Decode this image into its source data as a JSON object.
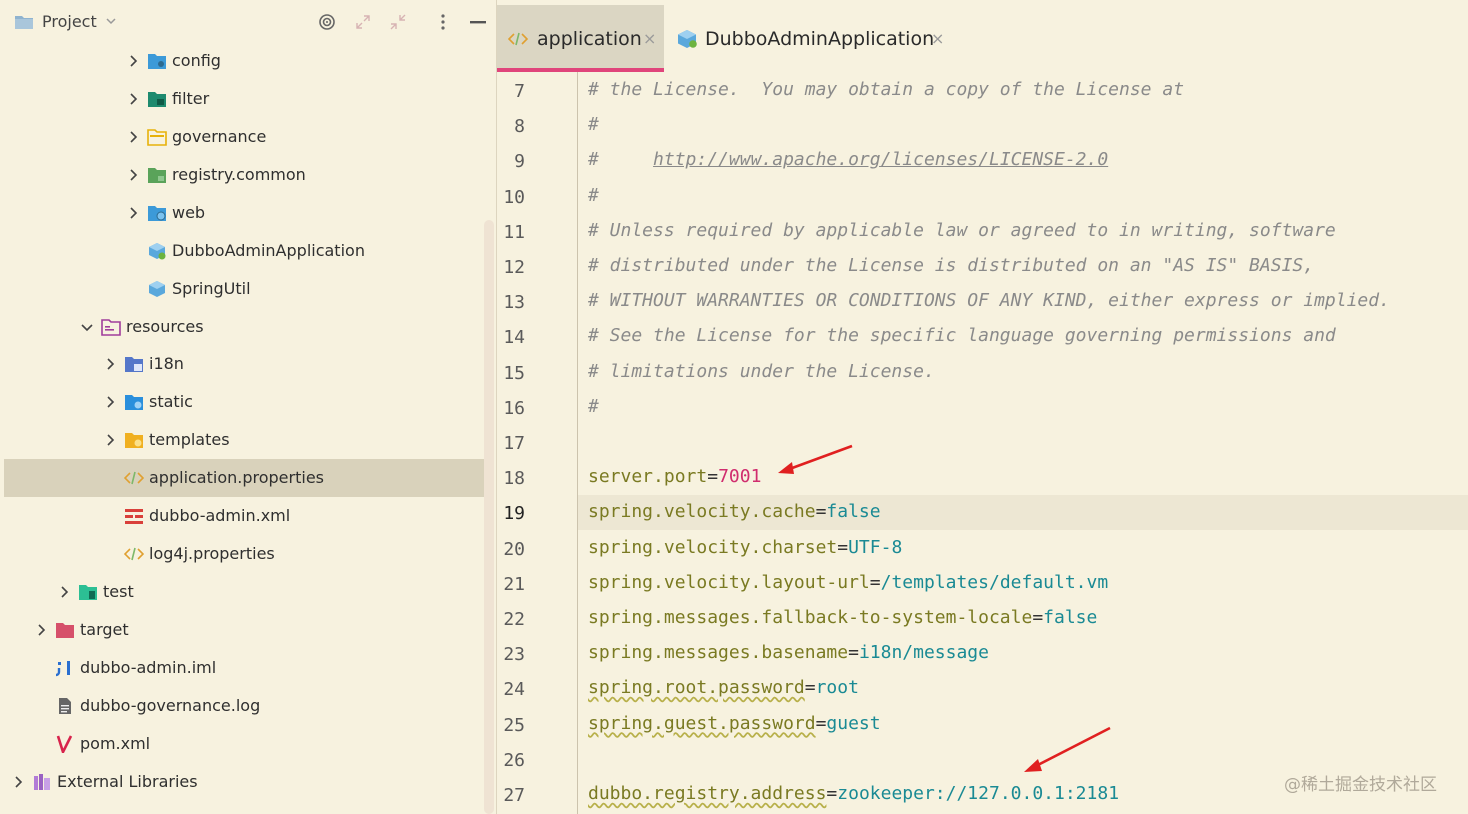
{
  "project_panel": {
    "title": "Project",
    "tree": [
      {
        "label": "config",
        "icon": "config-package-icon"
      },
      {
        "label": "filter",
        "icon": "filter-package-icon"
      },
      {
        "label": "governance",
        "icon": "folder-icon"
      },
      {
        "label": "registry.common",
        "icon": "package-icon"
      },
      {
        "label": "web",
        "icon": "web-package-icon"
      },
      {
        "label": "DubboAdminApplication",
        "icon": "spring-boot-class-icon"
      },
      {
        "label": "SpringUtil",
        "icon": "class-icon"
      },
      {
        "label": "resources",
        "icon": "resources-folder-icon"
      },
      {
        "label": "i18n",
        "icon": "i18n-folder-icon"
      },
      {
        "label": "static",
        "icon": "static-folder-icon"
      },
      {
        "label": "templates",
        "icon": "templates-folder-icon"
      },
      {
        "label": "application.properties",
        "icon": "properties-file-icon"
      },
      {
        "label": "dubbo-admin.xml",
        "icon": "xml-file-icon"
      },
      {
        "label": "log4j.properties",
        "icon": "properties-file-icon"
      },
      {
        "label": "test",
        "icon": "test-folder-icon"
      },
      {
        "label": "target",
        "icon": "target-folder-icon"
      },
      {
        "label": "dubbo-admin.iml",
        "icon": "iml-file-icon"
      },
      {
        "label": "dubbo-governance.log",
        "icon": "log-file-icon"
      },
      {
        "label": "pom.xml",
        "icon": "maven-icon"
      },
      {
        "label": "External Libraries",
        "icon": "library-icon"
      }
    ]
  },
  "editor": {
    "tabs": [
      {
        "label": "application",
        "icon": "properties-file-icon",
        "active": true
      },
      {
        "label": "DubboAdminApplication",
        "icon": "spring-boot-class-icon",
        "active": false
      }
    ],
    "current_line": 19,
    "lines": [
      {
        "n": "7",
        "comment": "# the License.  You may obtain a copy of the License at"
      },
      {
        "n": "8",
        "comment": "#"
      },
      {
        "n": "9",
        "comment": "#     ",
        "link": "http://www.apache.org/licenses/LICENSE-2.0"
      },
      {
        "n": "10",
        "comment": "#"
      },
      {
        "n": "11",
        "comment": "# Unless required by applicable law or agreed to in writing, software"
      },
      {
        "n": "12",
        "comment": "# distributed under the License is distributed on an \"AS IS\" BASIS,"
      },
      {
        "n": "13",
        "comment": "# WITHOUT WARRANTIES OR CONDITIONS OF ANY KIND, either express or implied."
      },
      {
        "n": "14",
        "comment": "# See the License for the specific language governing permissions and"
      },
      {
        "n": "15",
        "comment": "# limitations under the License."
      },
      {
        "n": "16",
        "comment": "#"
      },
      {
        "n": "17"
      },
      {
        "n": "18",
        "key": "server.port",
        "value": "7001"
      },
      {
        "n": "19",
        "key": "spring.velocity.cache",
        "value": "false"
      },
      {
        "n": "20",
        "key": "spring.velocity.charset",
        "value": "UTF-8"
      },
      {
        "n": "21",
        "key": "spring.velocity.layout-url",
        "value": "/templates/default.vm"
      },
      {
        "n": "22",
        "key": "spring.messages.fallback-to-system-locale",
        "value": "false"
      },
      {
        "n": "23",
        "key": "spring.messages.basename",
        "value": "i18n/message"
      },
      {
        "n": "24",
        "key": "spring.root.password",
        "value": "root"
      },
      {
        "n": "25",
        "key": "spring.guest.password",
        "value": "guest"
      },
      {
        "n": "26"
      },
      {
        "n": "27",
        "key": "dubbo.registry.address",
        "value": "zookeeper://127.0.0.1:2181"
      }
    ]
  },
  "watermark": "@稀土掘金技术社区",
  "colors": {
    "background": "#f7f2df",
    "active_tab_underline": "#e0457b",
    "annotation_arrow": "#e02020"
  }
}
